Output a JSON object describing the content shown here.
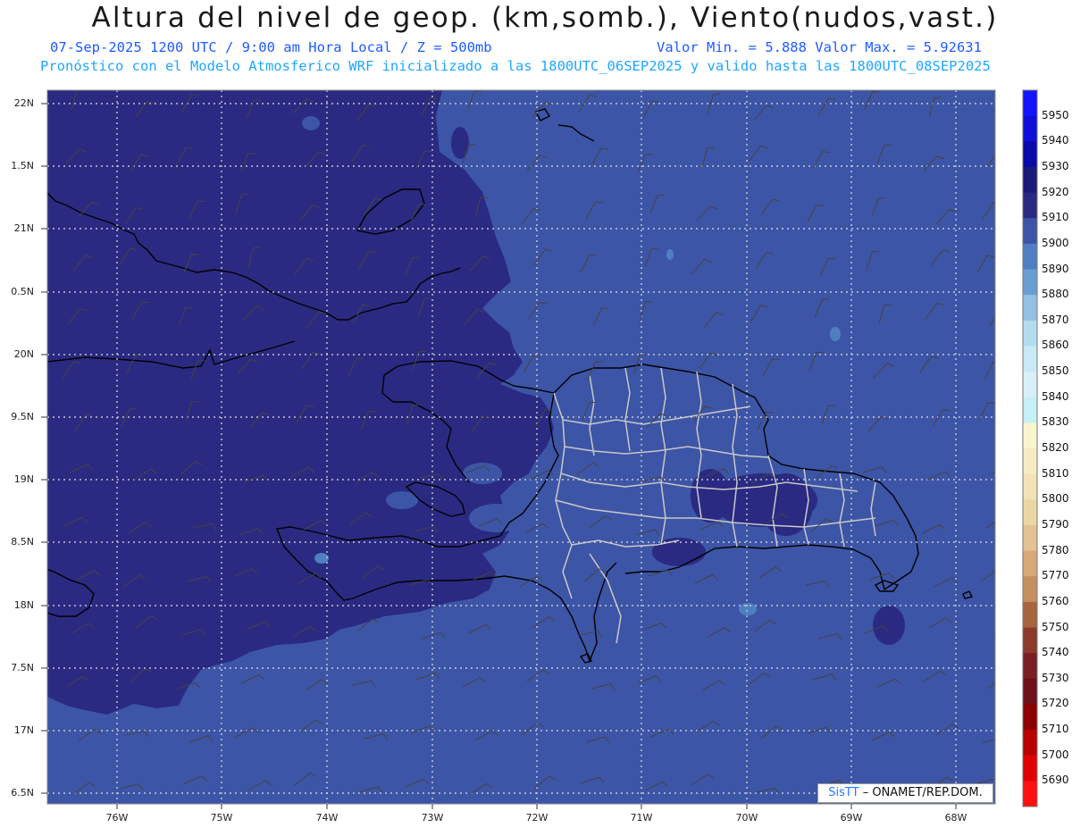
{
  "header": {
    "title": "Altura del nivel de geop. (km,somb.), Viento(nudos,vast.)",
    "line1_left": "07-Sep-2025  1200 UTC / 9:00 am Hora Local / Z = 500mb",
    "line1_right": "Valor Min. = 5.888  Valor Max. = 5.92631",
    "line2": "Pronóstico con el Modelo Atmosferico WRF inicializado a las 1800UTC_06SEP2025 y valido hasta las  1800UTC_08SEP2025"
  },
  "map": {
    "lat_labels": [
      "22N",
      "1.5N",
      "21N",
      "0.5N",
      "20N",
      "9.5N",
      "19N",
      "8.5N",
      "18N",
      "7.5N",
      "17N",
      "6.5N"
    ],
    "lon_labels": [
      "76W",
      "75W",
      "74W",
      "73W",
      "72W",
      "71W",
      "70W",
      "69W",
      "68W"
    ],
    "colors": {
      "field_high": "#2a2a82",
      "field_mid": "#3d55a6",
      "field_low": "#4f7fc0",
      "coast": "#000000",
      "provinces": "#c8c8c8",
      "grid": "#d8d8d8"
    }
  },
  "colorbar": {
    "levels": [
      "5950",
      "5940",
      "5930",
      "5920",
      "5910",
      "5900",
      "5890",
      "5880",
      "5870",
      "5860",
      "5850",
      "5840",
      "5830",
      "5820",
      "5810",
      "5800",
      "5790",
      "5780",
      "5770",
      "5760",
      "5750",
      "5740",
      "5730",
      "5720",
      "5710",
      "5700",
      "5690"
    ],
    "colors": [
      "#1414ff",
      "#0f0fd9",
      "#0a0aa8",
      "#1a1a78",
      "#2a2a82",
      "#3d55a6",
      "#4f7fc0",
      "#6a9ed3",
      "#93c1e4",
      "#b3dcef",
      "#c8e9f5",
      "#d8f1f9",
      "#c4f0f6",
      "#fbf4d0",
      "#f6ebc2",
      "#f2e2b6",
      "#ecd6a6",
      "#e3c393",
      "#d6a978",
      "#c49060",
      "#a8643f",
      "#8a3b2c",
      "#7a1f25",
      "#70101a",
      "#8c0000",
      "#b80000",
      "#e00000",
      "#ff1010"
    ]
  },
  "credit": {
    "brand": "SisTT",
    "text": "– ONAMET/REP.DOM."
  }
}
